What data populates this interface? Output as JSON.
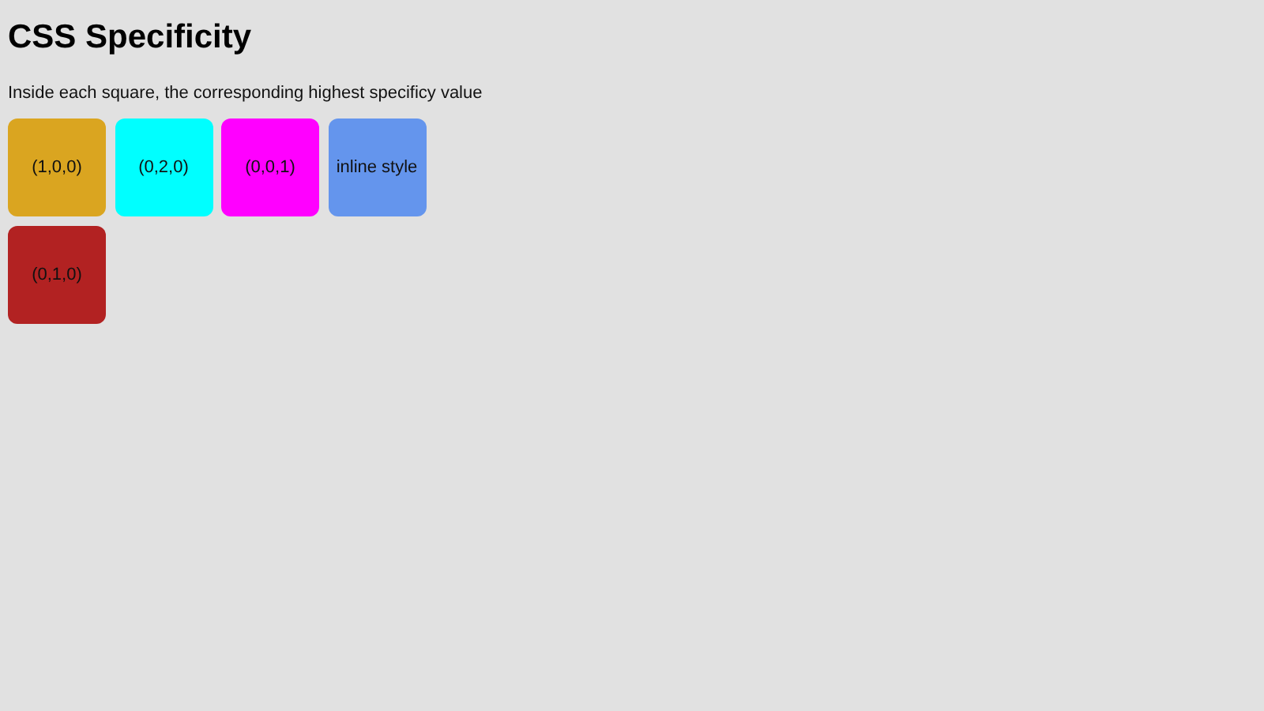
{
  "title": "CSS Specificity",
  "description": "Inside each square, the corresponding highest specificy value",
  "squares": [
    {
      "label": "(1,0,0)",
      "color": "#daa520"
    },
    {
      "label": "(0,2,0)",
      "color": "#00ffff"
    },
    {
      "label": "(0,0,1)",
      "color": "#ff00ff"
    },
    {
      "label": "inline style",
      "color": "#6495ed"
    },
    {
      "label": "(0,1,0)",
      "color": "#b22222"
    }
  ]
}
